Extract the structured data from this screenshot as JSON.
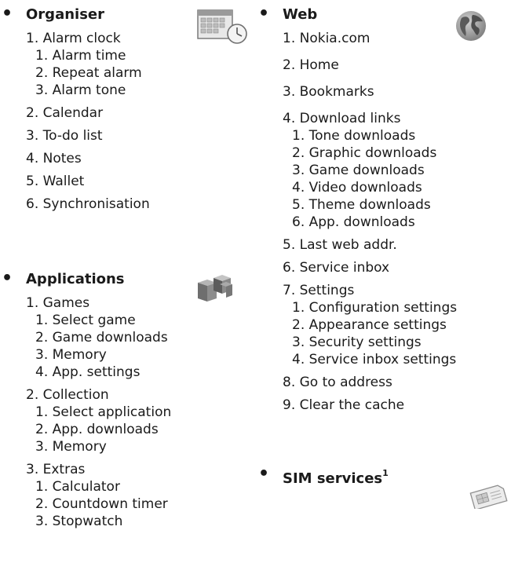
{
  "left_column": {
    "organiser": {
      "title": "Organiser",
      "icon": "calendar-clock-icon",
      "items": [
        {
          "label": "1. Alarm clock",
          "sub": [
            "1. Alarm time",
            "2. Repeat alarm",
            "3. Alarm tone"
          ]
        },
        {
          "label": "2. Calendar",
          "sub": []
        },
        {
          "label": "3. To-do list",
          "sub": []
        },
        {
          "label": "4. Notes",
          "sub": []
        },
        {
          "label": "5. Wallet",
          "sub": []
        },
        {
          "label": "6. Synchronisation",
          "sub": []
        }
      ]
    },
    "applications": {
      "title": "Applications",
      "icon": "cubes-icon",
      "items": [
        {
          "label": "1. Games",
          "sub": [
            "1. Select game",
            "2. Game downloads",
            "3. Memory",
            "4. App. settings"
          ]
        },
        {
          "label": "2. Collection",
          "sub": [
            "1. Select application",
            "2. App. downloads",
            "3. Memory"
          ]
        },
        {
          "label": "3. Extras",
          "sub": [
            "1. Calculator",
            "2. Countdown timer",
            "3. Stopwatch"
          ]
        }
      ]
    }
  },
  "right_column": {
    "web": {
      "title": "Web",
      "icon": "globe-icon",
      "items": [
        {
          "label": "1. Nokia.com",
          "sub": []
        },
        {
          "label": "2. Home",
          "sub": []
        },
        {
          "label": "3. Bookmarks",
          "sub": []
        },
        {
          "label": "4. Download links",
          "sub": [
            "1. Tone downloads",
            "2. Graphic downloads",
            "3. Game downloads",
            "4. Video downloads",
            "5. Theme downloads",
            "6. App. downloads"
          ]
        },
        {
          "label": "5. Last web addr.",
          "sub": []
        },
        {
          "label": "6. Service inbox",
          "sub": []
        },
        {
          "label": "7. Settings",
          "sub": [
            "1. Configuration settings",
            "2. Appearance settings",
            "3. Security settings",
            "4. Service inbox settings"
          ]
        },
        {
          "label": "8. Go to address",
          "sub": []
        },
        {
          "label": "9. Clear the cache",
          "sub": []
        }
      ]
    },
    "sim": {
      "title": "SIM services",
      "superscript": "1",
      "icon": "sim-card-icon"
    }
  },
  "bullet_char": "•"
}
